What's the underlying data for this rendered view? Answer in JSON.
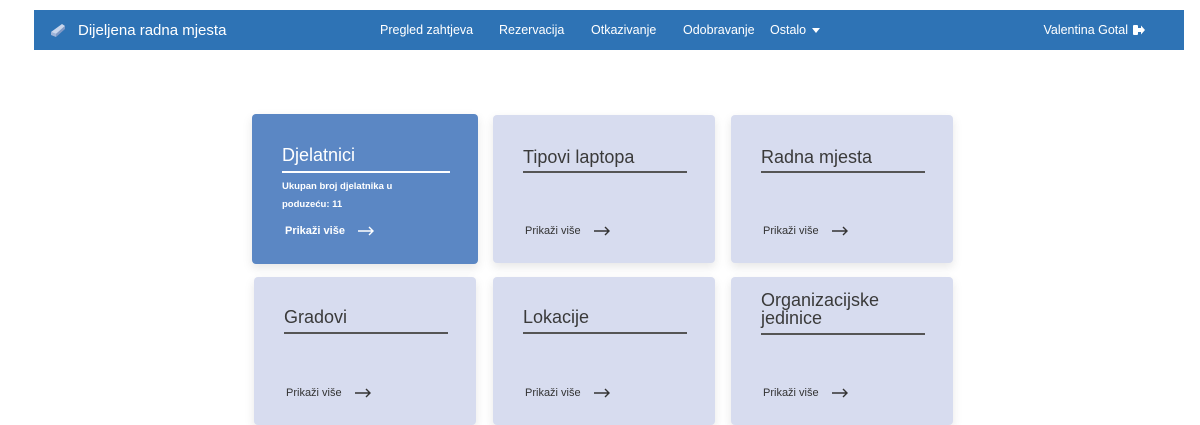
{
  "brand": {
    "title": "Dijeljena radna mjesta",
    "icon": "chair-icon"
  },
  "nav": {
    "items": [
      "Pregled zahtjeva",
      "Rezervacija",
      "Otkazivanje",
      "Odobravanje"
    ],
    "dropdown_label": "Ostalo"
  },
  "user": {
    "name": "Valentina Gotal",
    "logout_icon": "logout-icon"
  },
  "colors": {
    "topbar": "#2e73b5",
    "card": "#d7dcef",
    "card_active": "#5b87c4"
  },
  "cards": [
    {
      "title": "Djelatnici",
      "description": "Ukupan broj djelatnika u poduzeću: 11",
      "link": "Prikaži više"
    },
    {
      "title": "Tipovi laptopa",
      "link": "Prikaži više"
    },
    {
      "title": "Radna mjesta",
      "link": "Prikaži više"
    },
    {
      "title": "Gradovi",
      "link": "Prikaži više"
    },
    {
      "title": "Lokacije",
      "link": "Prikaži više"
    },
    {
      "title": "Organizacijske jedinice",
      "link": "Prikaži više"
    }
  ]
}
